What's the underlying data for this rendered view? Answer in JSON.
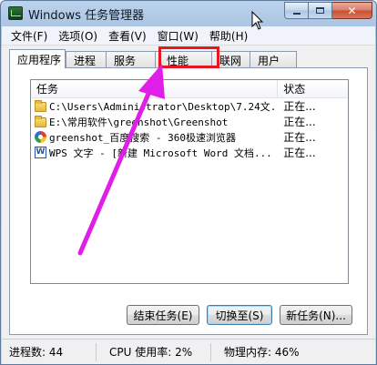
{
  "window": {
    "title": "Windows 任务管理器",
    "close_glyph": "✕"
  },
  "menu": {
    "items": [
      "文件(F)",
      "选项(O)",
      "查看(V)",
      "窗口(W)",
      "帮助(H)"
    ]
  },
  "tabs": {
    "applications": "应用程序",
    "processes": "进程",
    "services": "服务",
    "performance": "性能",
    "networking": "联网",
    "users": "用户"
  },
  "table": {
    "columns": {
      "task": "任务",
      "status": "状态"
    },
    "rows": [
      {
        "icon": "folder-icon",
        "task": "C:\\Users\\Administrator\\Desktop\\7.24文...",
        "status": "正在..."
      },
      {
        "icon": "folder-icon",
        "task": "E:\\常用软件\\greenshot\\Greenshot",
        "status": "正在..."
      },
      {
        "icon": "browser-360-icon",
        "task": "greenshot_百度搜索 - 360极速浏览器",
        "status": "正在..."
      },
      {
        "icon": "wps-icon",
        "task": "WPS 文字 - [新建 Microsoft Word 文档...",
        "status": "正在..."
      }
    ]
  },
  "buttons": {
    "end_task": "结束任务(E)",
    "switch_to": "切换至(S)",
    "new_task": "新任务(N)..."
  },
  "statusbar": {
    "processes": "进程数: 44",
    "cpu": "CPU 使用率: 2%",
    "memory": "物理内存: 46%"
  },
  "annotation": {
    "highlight_color": "#e8141f",
    "arrow_color": "#e11de8"
  },
  "icons": {
    "wps_letter": "W"
  }
}
